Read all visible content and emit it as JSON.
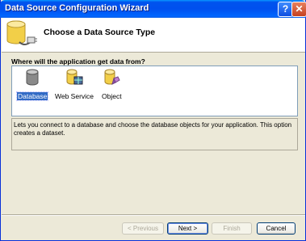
{
  "window": {
    "title": "Data Source Configuration Wizard",
    "help_glyph": "?",
    "close_glyph": "✕"
  },
  "header": {
    "title": "Choose a Data Source Type",
    "icon": "database-connection-icon"
  },
  "question": "Where will the application get data from?",
  "data_source_types": [
    {
      "label": "Database",
      "icon": "database-icon",
      "selected": true
    },
    {
      "label": "Web Service",
      "icon": "web-service-icon",
      "selected": false
    },
    {
      "label": "Object",
      "icon": "object-icon",
      "selected": false
    }
  ],
  "description": "Lets you connect to a database and choose the database objects for your application. This option creates a dataset.",
  "buttons": {
    "previous": "< Previous",
    "next": "Next >",
    "finish": "Finish",
    "cancel": "Cancel"
  },
  "colors": {
    "titlebar": "#0054e3",
    "selection": "#316ac5",
    "dialog_bg": "#ece9d8"
  }
}
